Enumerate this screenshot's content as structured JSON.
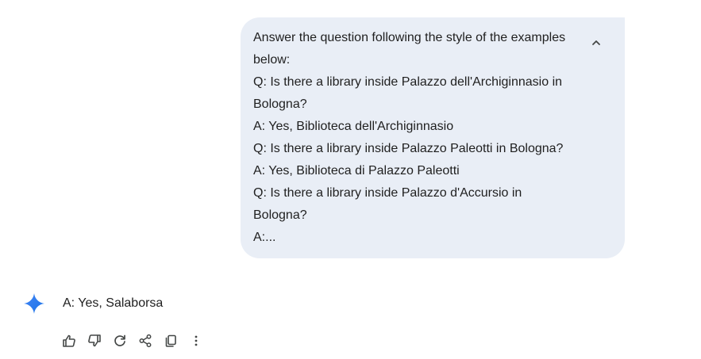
{
  "prompt": {
    "lines": [
      "Answer the question following the style of the examples",
      "below:",
      "Q: Is there a library inside Palazzo dell'Archiginnasio in",
      "Bologna?",
      "A: Yes, Biblioteca dell'Archiginnasio",
      "Q: Is there a library inside Palazzo Paleotti in Bologna?",
      "A: Yes, Biblioteca di Palazzo Paleotti",
      "Q: Is there a library inside Palazzo d'Accursio in",
      "Bologna?",
      "A:..."
    ],
    "collapse_icon": "chevron-up-icon",
    "bubble_color": "#e9eef6"
  },
  "response": {
    "text": "A: Yes, Salaborsa",
    "avatar_icon": "gemini-sparkle-icon",
    "avatar_colors": [
      "#4285f4",
      "#1a73e8"
    ]
  },
  "actions": [
    {
      "icon": "thumbs-up-icon"
    },
    {
      "icon": "thumbs-down-icon"
    },
    {
      "icon": "regenerate-icon"
    },
    {
      "icon": "share-icon"
    },
    {
      "icon": "copy-icon"
    },
    {
      "icon": "more-vert-icon"
    }
  ]
}
